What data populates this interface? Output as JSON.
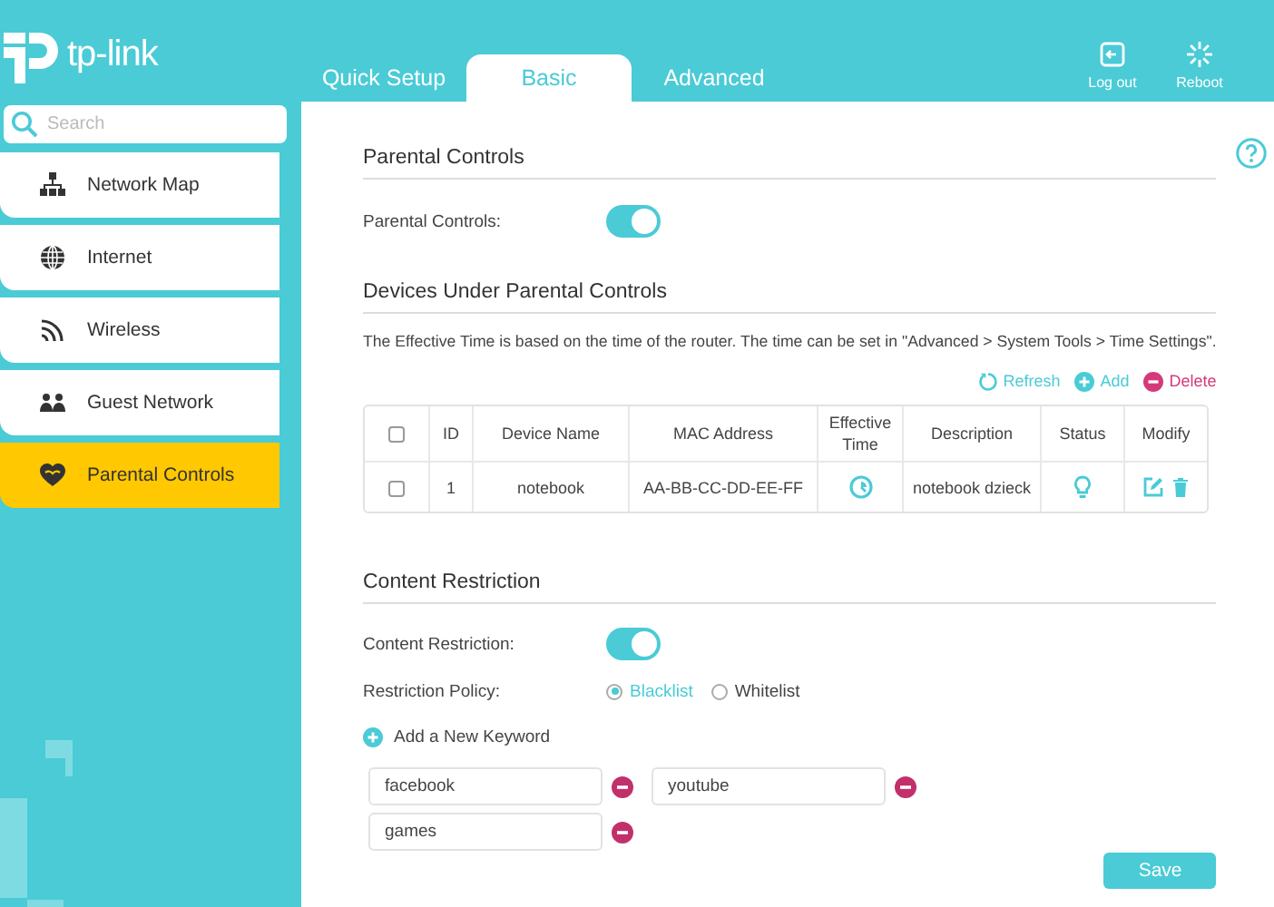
{
  "brand": {
    "name": "tp-link"
  },
  "nav_tabs": [
    {
      "label": "Quick Setup",
      "selected": false
    },
    {
      "label": "Basic",
      "selected": true
    },
    {
      "label": "Advanced",
      "selected": false
    }
  ],
  "header_actions": [
    {
      "label": "Log out",
      "kind": "logout"
    },
    {
      "label": "Reboot",
      "kind": "reboot"
    }
  ],
  "sidebar": {
    "search": {
      "placeholder": "Search"
    },
    "items": [
      {
        "label": "Network Map",
        "kind": "network",
        "selected": false
      },
      {
        "label": "Internet",
        "kind": "globe",
        "selected": false
      },
      {
        "label": "Wireless",
        "kind": "wireless",
        "selected": false
      },
      {
        "label": "Guest Network",
        "kind": "guest",
        "selected": false
      },
      {
        "label": "Parental Controls",
        "kind": "parental",
        "selected": true
      }
    ]
  },
  "parental_controls": {
    "title": "Parental Controls",
    "toggle": {
      "label": "Parental Controls:",
      "on": true
    }
  },
  "devices": {
    "title": "Devices Under Parental Controls",
    "note": "The Effective Time is based on the time of the router. The time can be set in \"Advanced > System Tools > Time Settings\".",
    "actions": [
      {
        "label": "Refresh",
        "kind": "refresh"
      },
      {
        "label": "Add",
        "kind": "add"
      },
      {
        "label": "Delete",
        "kind": "delete"
      }
    ],
    "table": {
      "select_all": {
        "checked": false
      },
      "columns": [
        "ID",
        "Device Name",
        "MAC Address",
        "Effective Time",
        "Description",
        "Status",
        "Modify"
      ],
      "rows": [
        {
          "checked": false,
          "id": "1",
          "device_name": "notebook",
          "mac_address": "AA-BB-CC-DD-EE-FF",
          "description": "notebook dzieck"
        }
      ]
    }
  },
  "content_restriction": {
    "title": "Content Restriction",
    "toggle": {
      "label": "Content Restriction:",
      "on": true
    },
    "policy": {
      "label": "Restriction Policy:",
      "options": [
        {
          "label": "Blacklist",
          "selected": true
        },
        {
          "label": "Whitelist",
          "selected": false
        }
      ]
    },
    "add_keyword": "Add a New Keyword",
    "keywords": [
      "facebook",
      "youtube",
      "games"
    ]
  },
  "save_button": "Save"
}
